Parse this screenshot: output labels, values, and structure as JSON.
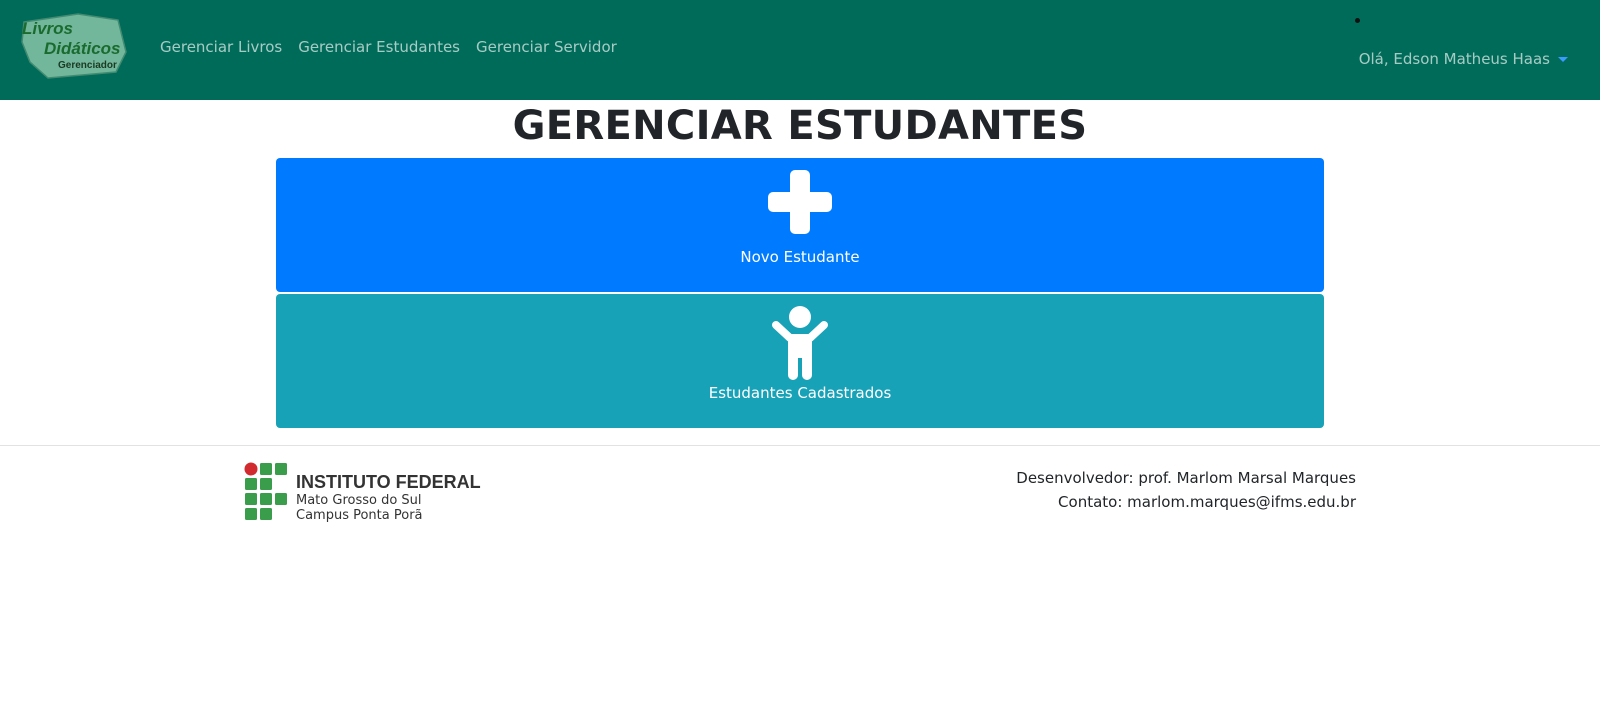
{
  "navbar": {
    "logo": {
      "line1": "Livros",
      "line2": "Didáticos",
      "line3": "Gerenciador"
    },
    "links": [
      {
        "label": "Gerenciar Livros"
      },
      {
        "label": "Gerenciar Estudantes"
      },
      {
        "label": "Gerenciar Servidor"
      }
    ],
    "user_greeting": "Olá, Edson Matheus Haas"
  },
  "main": {
    "title": "GERENCIAR ESTUDANTES",
    "cards": [
      {
        "label": "Novo Estudante",
        "icon": "plus-icon",
        "color": "#007bff"
      },
      {
        "label": "Estudantes Cadastrados",
        "icon": "child-icon",
        "color": "#17a2b8"
      }
    ]
  },
  "footer": {
    "institution": {
      "name": "INSTITUTO FEDERAL",
      "state": "Mato Grosso do Sul",
      "campus": "Campus Ponta Porã"
    },
    "developer": "Desenvolvedor: prof. Marlom Marsal Marques",
    "contact": "Contato: marlom.marques@ifms.edu.br"
  },
  "colors": {
    "navbar": "#006b59",
    "primary": "#007bff",
    "info": "#17a2b8",
    "if_green": "#3a9d4b",
    "if_red": "#d12a2f"
  }
}
